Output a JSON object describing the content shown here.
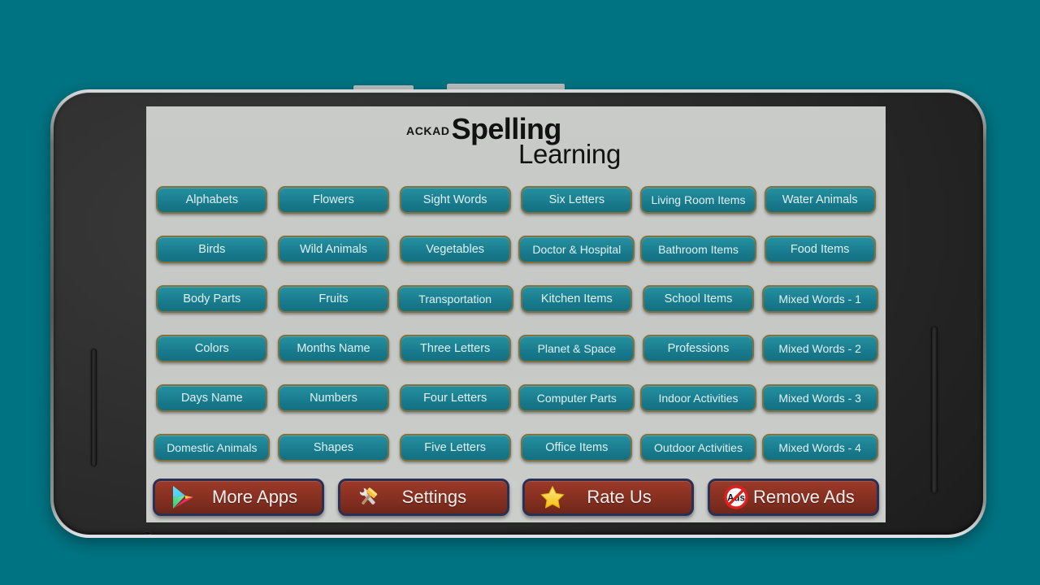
{
  "app": {
    "brand": "ACKAD",
    "title_main": "Spelling",
    "title_sub": "Learning"
  },
  "colors": {
    "background": "#007382",
    "screen_bg": "#c8cac8",
    "category_button_fill": "#1d8394",
    "category_button_border": "#7e7242",
    "category_button_text": "#dff1f5",
    "action_button_fill": "#8e3323",
    "action_button_border": "#2a2f54",
    "action_button_text": "#f2eeec"
  },
  "categories": [
    "Alphabets",
    "Flowers",
    "Sight Words",
    "Six Letters",
    "Living Room Items",
    "Water Animals",
    "Birds",
    "Wild Animals",
    "Vegetables",
    "Doctor & Hospital",
    "Bathroom Items",
    "Food Items",
    "Body Parts",
    "Fruits",
    "Transportation",
    "Kitchen Items",
    "School Items",
    "Mixed Words - 1",
    "Colors",
    "Months Name",
    "Three Letters",
    "Planet & Space",
    "Professions",
    "Mixed Words - 2",
    "Days Name",
    "Numbers",
    "Four Letters",
    "Computer Parts",
    "Indoor Activities",
    "Mixed Words - 3",
    "Domestic Animals",
    "Shapes",
    "Five Letters",
    "Office Items",
    "Outdoor Activities",
    "Mixed Words - 4"
  ],
  "actions": [
    {
      "label": "More Apps",
      "icon": "google-play-icon"
    },
    {
      "label": "Settings",
      "icon": "tools-icon"
    },
    {
      "label": "Rate Us",
      "icon": "star-icon"
    },
    {
      "label": "Remove Ads",
      "icon": "no-ads-icon"
    }
  ],
  "device": {
    "type": "android-phone-landscape",
    "buttons": [
      "volume-button",
      "power-button"
    ],
    "camera": "front-camera-lens"
  }
}
